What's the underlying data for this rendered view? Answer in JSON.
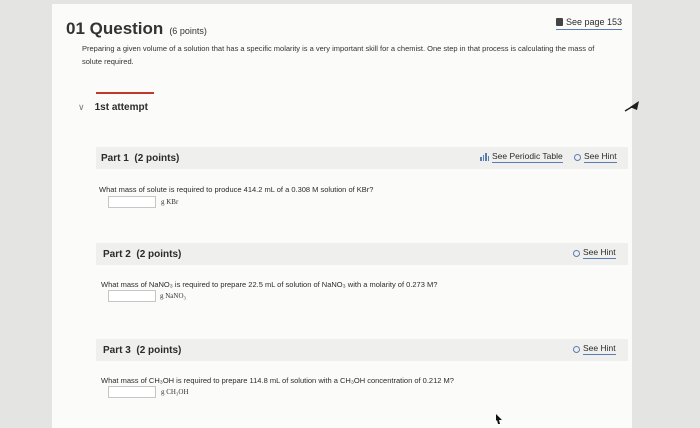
{
  "question": {
    "number_title": "01 Question",
    "points": "(6 points)",
    "see_page": "See page 153",
    "text": "Preparing a given volume of a solution that has a specific molarity is a very important skill for a chemist. One step in that process is calculating the mass of solute required."
  },
  "attempt": {
    "label": "1st attempt"
  },
  "parts": [
    {
      "title": "Part 1",
      "points": "(2 points)",
      "tools": {
        "periodic_table": "See Periodic Table",
        "hint": "See Hint"
      },
      "prompt": "What mass of solute is required to produce 414.2 mL of a 0.308 M solution of KBr?",
      "answer_value": "",
      "unit": "g KBr"
    },
    {
      "title": "Part 2",
      "points": "(2 points)",
      "tools": {
        "hint": "See Hint"
      },
      "prompt": "What mass of NaNO₃ is required to prepare 22.5 mL of solution of NaNO₃ with a molarity of 0.273 M?",
      "answer_value": "",
      "unit": "g NaNO₃"
    },
    {
      "title": "Part 3",
      "points": "(2 points)",
      "tools": {
        "hint": "See Hint"
      },
      "prompt": "What mass of CH₃OH is required to prepare 114.8 mL of solution with a CH₃OH concentration of 0.212 M?",
      "answer_value": "",
      "unit": "g CH₃OH"
    }
  ],
  "icons": {
    "book": "book-icon",
    "hint": "lightbulb-hint-icon",
    "periodic": "bar-chart-icon",
    "chevron": "chevron-down-icon",
    "nav": "arrow-up-icon"
  },
  "colors": {
    "accent": "#c0392b",
    "link": "#5b7db5",
    "bar": "#efefee"
  }
}
